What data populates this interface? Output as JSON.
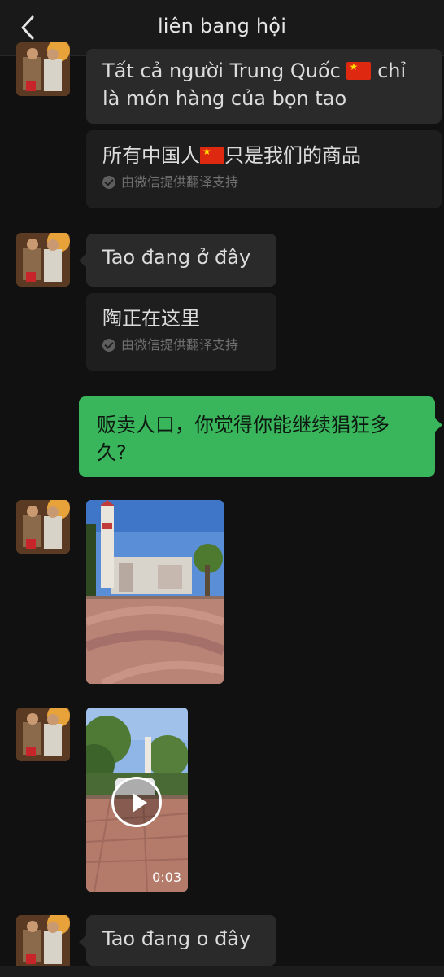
{
  "header": {
    "title": "liên bang hội"
  },
  "messages": {
    "m1": {
      "text_before_flag": "Tất cả người Trung Quốc ",
      "text_after_flag": " chỉ",
      "text_line2": "là món hàng của bọn tao",
      "translation_before_flag": "所有中国人",
      "translation_after_flag": "只是我们的商品",
      "translation_note": "由微信提供翻译支持"
    },
    "m2": {
      "text": "Tao đang ở đây",
      "translation": "陶正在这里",
      "translation_note": "由微信提供翻译支持"
    },
    "m3": {
      "line1": "贩卖人口，你觉得你能继续猖狂多",
      "line2": "久?"
    },
    "m5": {
      "duration": "0:03"
    },
    "m6": {
      "text": "Tao đang o đây"
    }
  },
  "colors": {
    "outgoing_bubble": "#39b55c",
    "incoming_bubble": "#2a2a2a",
    "background": "#111111"
  }
}
